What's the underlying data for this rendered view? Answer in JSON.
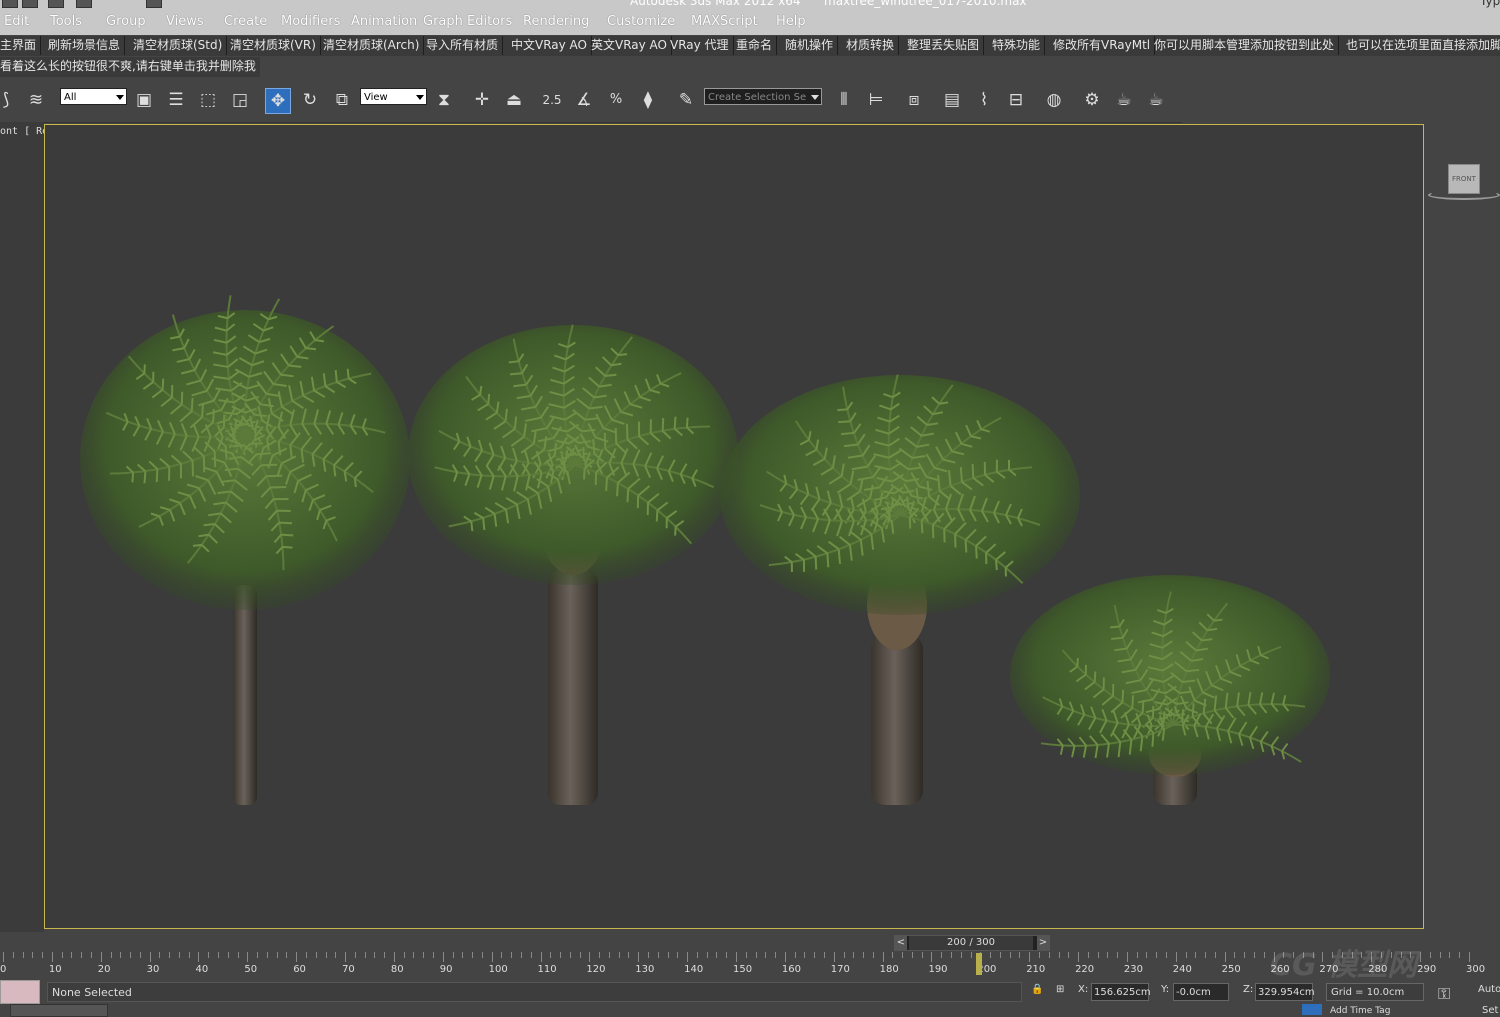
{
  "window": {
    "app_title": "Autodesk 3ds Max  2012 x64",
    "file_title": "maxtree_windtree_017-2010.max",
    "search_hint": "Typ"
  },
  "menu": {
    "items": [
      "Edit",
      "Tools",
      "Group",
      "Views",
      "Create",
      "Modifiers",
      "Animation",
      "Graph Editors",
      "Rendering",
      "Customize",
      "MAXScript",
      "Help"
    ]
  },
  "script_toolbar": {
    "row1": [
      "主界面",
      "刷新场景信息",
      "清空材质球(Std)",
      "清空材质球(VR)",
      "清空材质球(Arch)",
      "导入所有材质",
      "中文VRay AO",
      "英文VRay AO",
      "VRay 代理",
      "重命名",
      "随机操作",
      "材质转换",
      "整理丢失贴图",
      "特殊功能",
      "修改所有VRayMtl",
      "你可以用脚本管理添加按钮到此处",
      "也可以在选项里面直接添加脚"
    ],
    "row2": [
      "看着这么长的按钮很不爽,请右键单击我并删除我"
    ]
  },
  "main_toolbar": {
    "selection_filter": "All",
    "ref_coord": "View",
    "snap_angle_label": "2.5",
    "snap_percent_label": "%",
    "named_selection_placeholder": "Create Selection Se"
  },
  "viewport": {
    "label": "ont [ Realistic ]",
    "viewcube_face": "FRONT"
  },
  "timeline": {
    "frame_display": "200 / 300",
    "prev": "<",
    "next": ">",
    "current_frame": 200,
    "ticks": [
      "0",
      "10",
      "20",
      "30",
      "40",
      "50",
      "60",
      "70",
      "80",
      "90",
      "100",
      "110",
      "120",
      "130",
      "140",
      "150",
      "160",
      "170",
      "180",
      "190",
      "200",
      "210",
      "220",
      "230",
      "240",
      "250",
      "260",
      "270",
      "280",
      "290",
      "300"
    ]
  },
  "status": {
    "selection": "None Selected",
    "x_label": "X:",
    "x_value": "156.625cm",
    "y_label": "Y:",
    "y_value": "-0.0cm",
    "z_label": "Z:",
    "z_value": "329.954cm",
    "grid": "Grid = 10.0cm",
    "auto": "Auto",
    "set": "Set",
    "add_time_tag": "Add Time Tag",
    "watermark": "CG 模型网"
  },
  "colors": {
    "viewport_bg": "#3b3b3b",
    "viewport_border": "#c8b84a",
    "active_tool": "#2e6fbd"
  }
}
